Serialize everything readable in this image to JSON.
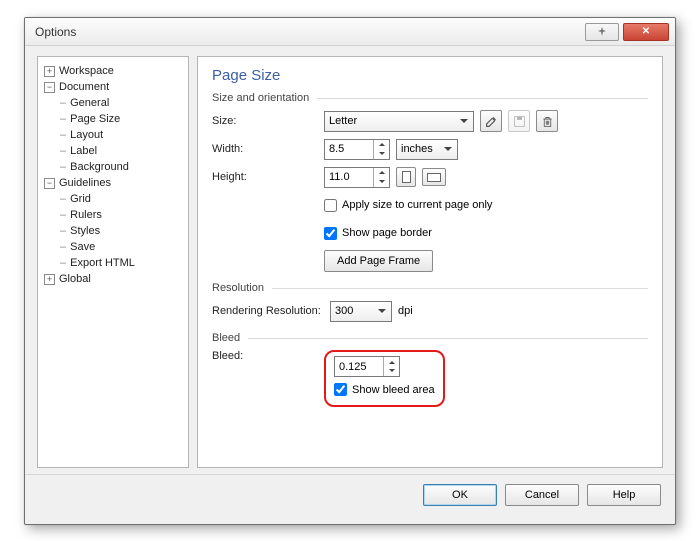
{
  "window": {
    "title": "Options"
  },
  "tree": {
    "workspace": "Workspace",
    "document": "Document",
    "doc_items": [
      "General",
      "Page Size",
      "Layout",
      "Label",
      "Background"
    ],
    "guidelines": "Guidelines",
    "guide_items": [
      "Grid",
      "Rulers",
      "Styles",
      "Save",
      "Export HTML"
    ],
    "global": "Global"
  },
  "page": {
    "title": "Page Size",
    "group_size": "Size and orientation",
    "size_label": "Size:",
    "size_value": "Letter",
    "width_label": "Width:",
    "width_value": "8.5",
    "units_value": "inches",
    "height_label": "Height:",
    "height_value": "11.0",
    "apply_current": "Apply size to current page only",
    "show_border": "Show page border",
    "add_frame": "Add Page Frame",
    "group_res": "Resolution",
    "res_label": "Rendering Resolution:",
    "res_value": "300",
    "res_unit": "dpi",
    "group_bleed": "Bleed",
    "bleed_label": "Bleed:",
    "bleed_value": "0.125",
    "show_bleed": "Show bleed area"
  },
  "buttons": {
    "ok": "OK",
    "cancel": "Cancel",
    "help": "Help"
  }
}
